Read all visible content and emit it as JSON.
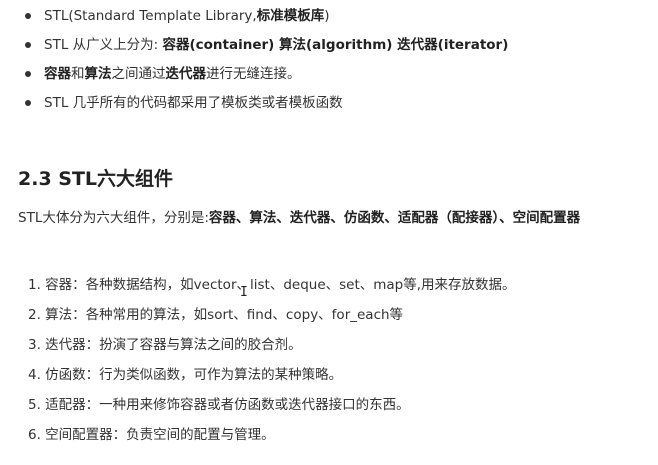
{
  "bullets": [
    {
      "t1": "STL(Standard Template Library,",
      "b1": "标准模板库",
      "t2": ")"
    },
    {
      "t1": "STL 从广义上分为: ",
      "b1": "容器(container) 算法(algorithm) 迭代器(iterator)"
    },
    {
      "b1": "容器",
      "t1": "和",
      "b2": "算法",
      "t2": "之间通过",
      "b3": "迭代器",
      "t3": "进行无缝连接。"
    },
    {
      "t1": "STL 几乎所有的代码都采用了模板类或者模板函数"
    }
  ],
  "section": {
    "title": "2.3 STL六大组件",
    "intro_prefix": "STL大体分为六大组件，分别是:",
    "intro_bold": "容器、算法、迭代器、仿函数、适配器（配接器）、空间配置器"
  },
  "components": [
    "1. 容器：各种数据结构，如vector、list、deque、set、map等,用来存放数据。",
    "2. 算法：各种常用的算法，如sort、find、copy、for_each等",
    "3. 迭代器：扮演了容器与算法之间的胶合剂。",
    "4. 仿函数：行为类似函数，可作为算法的某种策略。",
    "5. 适配器：一种用来修饰容器或者仿函数或迭代器接口的东西。",
    "6. 空间配置器：负责空间的配置与管理。"
  ],
  "cursor_icon": "text-cursor-icon"
}
